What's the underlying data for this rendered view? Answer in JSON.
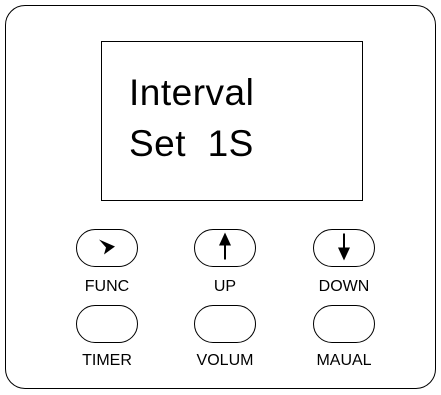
{
  "display": {
    "line1": "Interval",
    "line2": "Set  1S"
  },
  "buttons": [
    {
      "label": "FUNC",
      "icon": "arrow-bottom-right-icon"
    },
    {
      "label": "UP",
      "icon": "arrow-up-icon"
    },
    {
      "label": "DOWN",
      "icon": "arrow-down-icon"
    },
    {
      "label": "TIMER",
      "icon": ""
    },
    {
      "label": "VOLUM",
      "icon": ""
    },
    {
      "label": "MAUAL",
      "icon": ""
    }
  ]
}
